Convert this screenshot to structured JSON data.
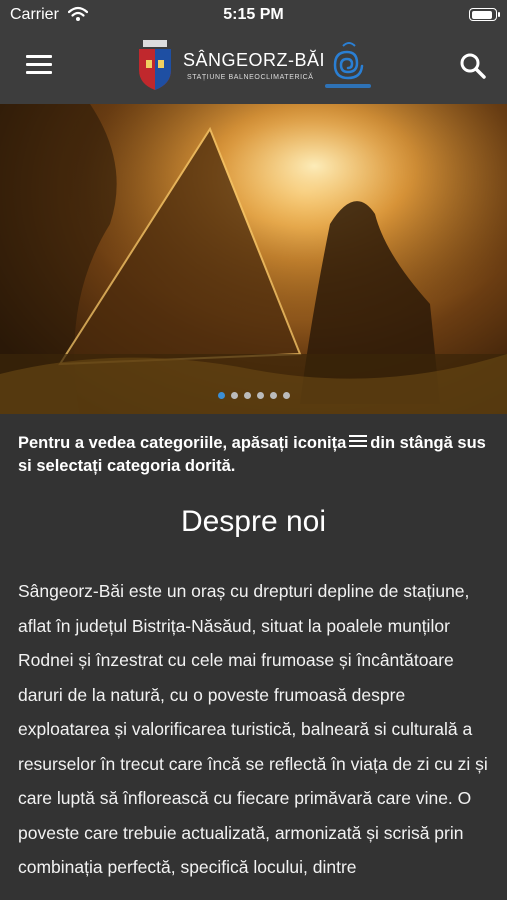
{
  "status_bar": {
    "carrier": "Carrier",
    "time": "5:15 PM",
    "battery_level": 0.95
  },
  "header": {
    "brand_title": "SÂNGEORZ-BĂI",
    "brand_subtitle": "STAȚIUNE BALNEOCLIMATERICĂ",
    "icons": [
      "menu-icon",
      "crest-icon",
      "spiral-logo-icon",
      "search-icon"
    ],
    "colors": {
      "bar": "#3d3d3d",
      "crest_red": "#c0282d",
      "crest_blue": "#1e4fa3",
      "spiral": "#2a7fd4"
    }
  },
  "carousel": {
    "slide_count": 6,
    "active_index": 0,
    "active_color": "#3b8fd6"
  },
  "instructions": {
    "text_before": "Pentru a vedea categoriile, apăsați iconița",
    "text_after": "din stângă sus si selectați categoria dorită."
  },
  "about": {
    "title": "Despre noi",
    "body": "Sângeorz-Băi este un oraș cu drepturi depline de stațiune, aflat în județul Bistrița-Năsăud, situat la poalele munților Rodnei și înzestrat cu cele mai frumoase și încântătoare daruri de la natură, cu o poveste frumoasă despre exploatarea și valorificarea turistică, balneară si culturală a resurselor în trecut care încă se reflectă în viața de zi cu zi și care luptă să înflorească cu fiecare primăvară care vine. O poveste care trebuie actualizată, armonizată și scrisă prin combinația perfectă, specifică locului, dintre"
  }
}
